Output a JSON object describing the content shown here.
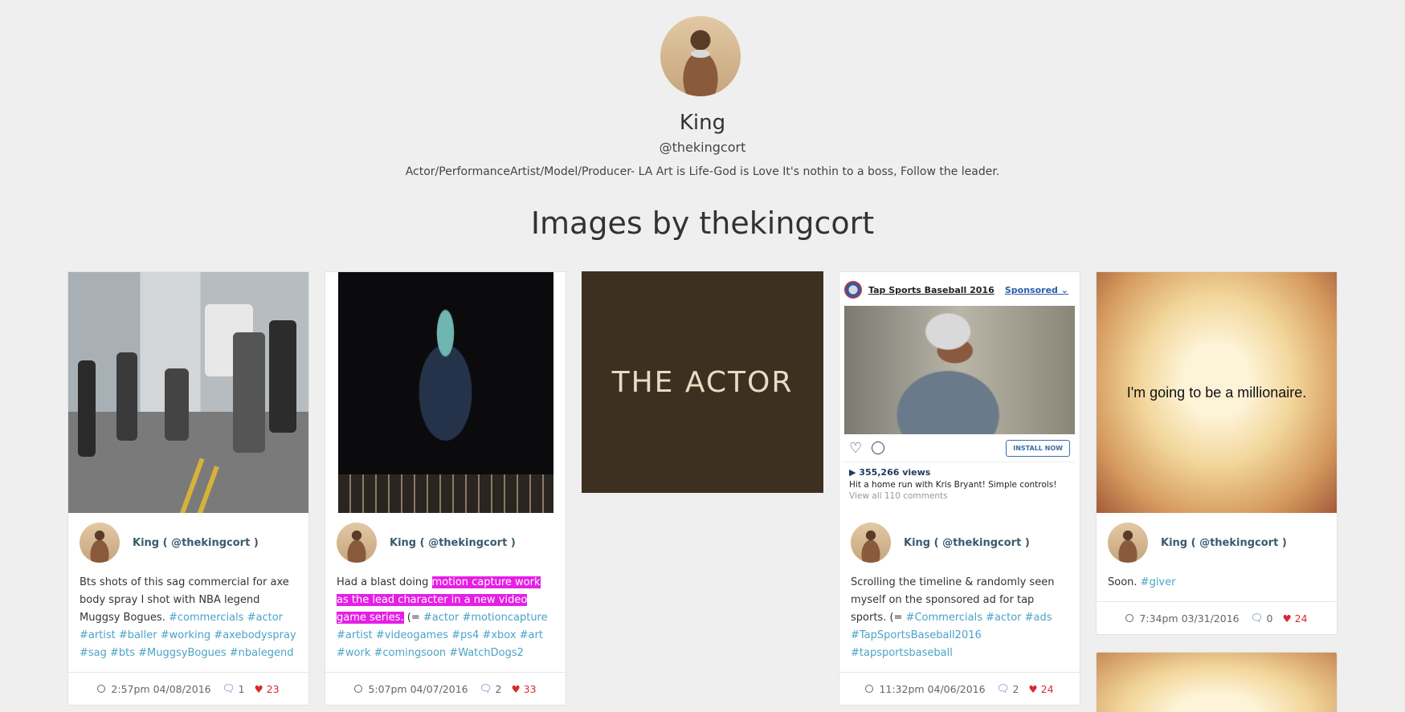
{
  "profile": {
    "name": "King",
    "handle": "@thekingcort",
    "bio": "Actor/PerformanceArtist/Model/Producer- LA Art is Life-God is Love It's nothin to a boss, Follow the leader."
  },
  "section_title": "Images by thekingcort",
  "posts": [
    {
      "user": "King ( @thekingcort )",
      "caption_text": "Bts shots of this sag commercial for axe body spray I shot with NBA legend Muggsy Bogues.",
      "tags": "#commercials #actor #artist #baller #working #axebodyspray #sag #bts #MuggsyBogues #nbalegend",
      "time": "2:57pm 04/08/2016",
      "comments": "1",
      "likes": "23"
    },
    {
      "user": "King ( @thekingcort )",
      "caption_pre": "Had a blast doing ",
      "caption_highlight": "motion capture work as the lead character in a new video game series.",
      "caption_post": " (=",
      "tags": "#actor #motioncapture #artist #videogames #ps4 #xbox #art #work #comingsoon #WatchDogs2",
      "time": "5:07pm 04/07/2016",
      "comments": "2",
      "likes": "33"
    },
    {
      "image_text": "THE ACTOR"
    },
    {
      "ad": {
        "title": "Tap Sports Baseball 2016",
        "sponsored": "Sponsored",
        "install": "INSTALL NOW",
        "views": "▶ 355,266 views",
        "text": "Hit a home run with Kris Bryant! Simple controls!",
        "comments": "View all 110 comments"
      },
      "user": "King ( @thekingcort )",
      "caption_text": "Scrolling the timeline & randomly seen myself on the sponsored ad for tap sports. (=",
      "tags": "#Commercials #actor #ads #TapSportsBaseball2016 #tapsportsbaseball",
      "time": "11:32pm 04/06/2016",
      "comments": "2",
      "likes": "24"
    },
    {
      "image_text": "I'm going to be a millionaire.",
      "user": "King ( @thekingcort )",
      "caption_text": "Soon.",
      "tags": "#giver",
      "time": "7:34pm 03/31/2016",
      "comments": "0",
      "likes": "24"
    }
  ],
  "colors": {
    "background": "#efefef",
    "tag": "#4ba3c7",
    "highlight": "#e61ee6",
    "heart": "#d9282f",
    "user_link": "#3a5a6e"
  },
  "icons": [
    "clock-icon",
    "comment-icon",
    "heart-icon",
    "chevron-down-icon",
    "play-icon"
  ]
}
